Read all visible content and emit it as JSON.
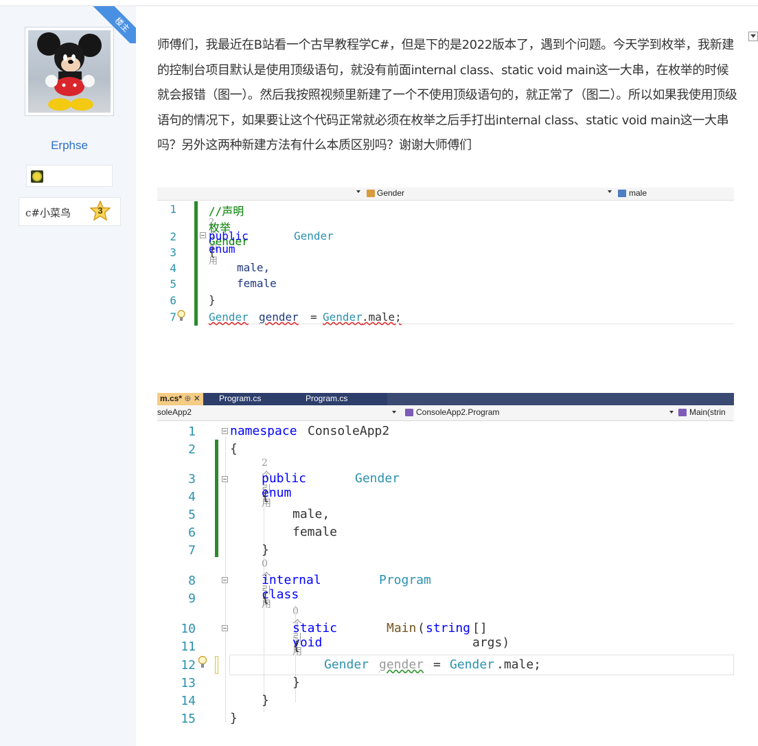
{
  "badge": {
    "label": "楼主"
  },
  "author": {
    "name": "Erphse",
    "rank_label": "c#小菜鸟",
    "rank_level": "3"
  },
  "post": {
    "text": "师傅们，我最近在B站看一个古早教程学C#，但是下的是2022版本了，遇到个问题。今天学到枚举，我新建的控制台项目默认是使用顶级语句，就没有前面internal class、static void main这一大串，在枚举的时候就会报错（图一）。然后我按照视频里新建了一个不使用顶级语句的，就正常了（图二）。所以如果我使用顶级语句的情况下，如果要让这个代码正常就必须在枚举之后手打出internal class、static void main这一大串吗？另外这两种新建方法有什么本质区别吗？谢谢大师傅们"
  },
  "screenshot1": {
    "nav_type": "Gender",
    "nav_member": "male",
    "ref_label": "2 个引用",
    "lines": [
      "1",
      "2",
      "3",
      "4",
      "5",
      "6",
      "7"
    ],
    "code": {
      "l1": "//声明枚举Gender",
      "l2_kw": "public enum",
      "l2_name": "Gender",
      "l3": "{",
      "l4": "male,",
      "l5": "female",
      "l6": "}",
      "l7_type": "Gender",
      "l7_var": "gender",
      "l7_eq": "=",
      "l7_type2": "Gender",
      "l7_rest": ".male;"
    }
  },
  "screenshot2": {
    "tabs": [
      "m.cs*",
      "Program.cs",
      "Program.cs"
    ],
    "tab_pin": "⊕",
    "tab_close": "✕",
    "nav_project": "soleApp2",
    "nav_class": "ConsoleApp2.Program",
    "nav_member": "Main(strin",
    "lines": [
      "1",
      "2",
      "3",
      "4",
      "5",
      "6",
      "7",
      "8",
      "9",
      "10",
      "11",
      "12",
      "13",
      "14",
      "15"
    ],
    "refs": {
      "r1": "2 个引用",
      "r2": "0 个引用",
      "r3": "0 个引用"
    },
    "code": {
      "l1_kw": "namespace",
      "l1_name": "ConsoleApp2",
      "l2": "{",
      "l3_kw": "public enum",
      "l3_name": "Gender",
      "l4": "{",
      "l5": "male,",
      "l6": "female",
      "l7": "}",
      "l8_kw": "internal class",
      "l8_name": "Program",
      "l9": "{",
      "l10_kw": "static void",
      "l10_name": "Main",
      "l10_open": "(",
      "l10_type": "string",
      "l10_rest": "[] args)",
      "l11": "{",
      "l12_type": "Gender",
      "l12_var": "gender",
      "l12_eq": "=",
      "l12_type2": "Gender",
      "l12_rest": ".male;",
      "l13": "}",
      "l14": "}",
      "l15": "}"
    }
  },
  "colors": {
    "link": "#2a6fc4",
    "keyword": "#0000ff",
    "type": "#2b91af",
    "comment": "#008000",
    "badge": "#4a90e2"
  }
}
